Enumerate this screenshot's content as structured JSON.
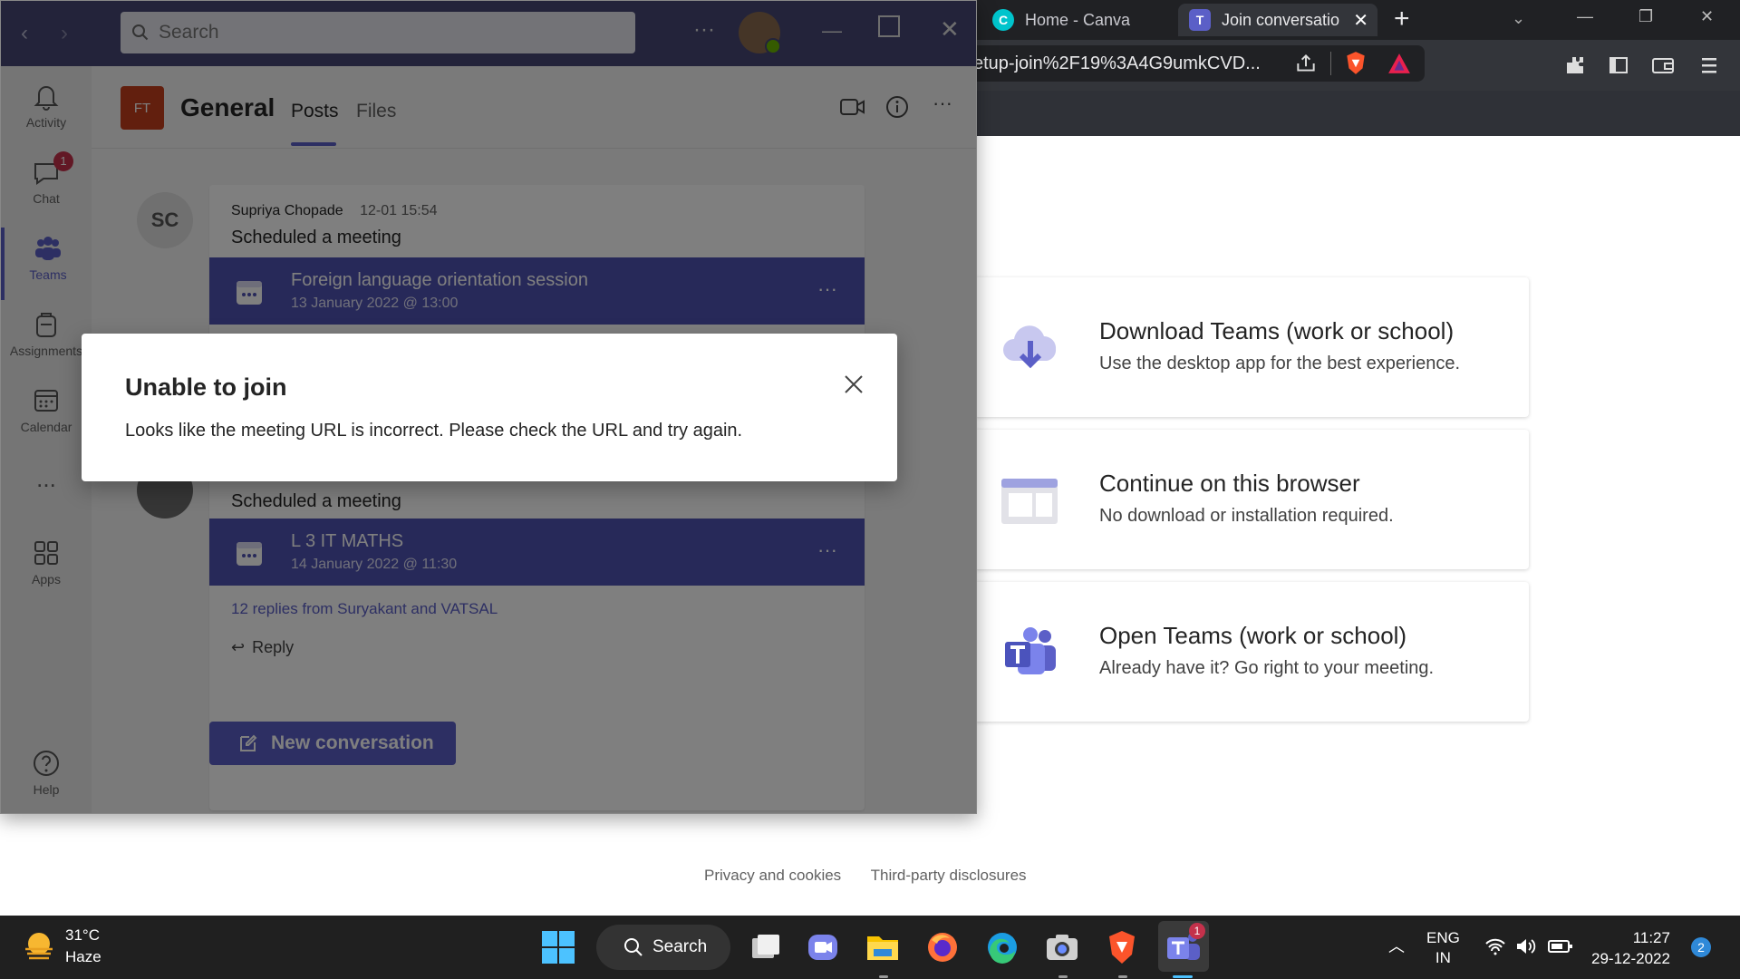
{
  "browser": {
    "tabs": [
      {
        "title": "Home - Canva",
        "icon": "canva-icon",
        "active": false
      },
      {
        "title": "Join conversatio",
        "icon": "teams-icon",
        "active": true
      }
    ],
    "url": "etup-join%2F19%3A4G9umkCVD..."
  },
  "join_options": [
    {
      "title": "Download Teams (work or school)",
      "subtitle": "Use the desktop app for the best experience.",
      "icon": "cloud-download-icon"
    },
    {
      "title": "Continue on this browser",
      "subtitle": "No download or installation required.",
      "icon": "browser-window-icon"
    },
    {
      "title": "Open Teams (work or school)",
      "subtitle": "Already have it? Go right to your meeting.",
      "icon": "teams-logo-icon"
    }
  ],
  "footer": {
    "privacy": "Privacy and cookies",
    "third_party": "Third-party disclosures"
  },
  "teams": {
    "search_placeholder": "Search",
    "rail": [
      {
        "label": "Activity",
        "icon": "bell-icon"
      },
      {
        "label": "Chat",
        "icon": "chat-icon",
        "badge": "1"
      },
      {
        "label": "Teams",
        "icon": "teams-icon",
        "active": true
      },
      {
        "label": "Assignments",
        "icon": "assignments-icon"
      },
      {
        "label": "Calendar",
        "icon": "calendar-icon"
      },
      {
        "label": "...",
        "icon": "more-icon"
      },
      {
        "label": "Apps",
        "icon": "apps-icon"
      },
      {
        "label": "Help",
        "icon": "help-icon"
      }
    ],
    "channel": {
      "avatar": "FT",
      "name": "General",
      "tabs": [
        "Posts",
        "Files"
      ]
    },
    "posts": [
      {
        "avatar": "SC",
        "author": "Supriya Chopade",
        "time": "12-01 15:54",
        "text": "Scheduled a meeting",
        "meeting": {
          "title": "Foreign language orientation session",
          "date": "13 January 2022 @ 13:00"
        }
      },
      {
        "text": "Scheduled a meeting",
        "meeting": {
          "title": "L 3 IT MATHS",
          "date": "14 January 2022 @ 11:30"
        },
        "replies": "12 replies from Suryakant and VATSAL",
        "reply_label": "Reply"
      }
    ],
    "new_conversation": "New conversation"
  },
  "dialog": {
    "title": "Unable to join",
    "message": "Looks like the meeting URL is incorrect. Please check the URL and try again."
  },
  "taskbar": {
    "weather": {
      "temp": "31°C",
      "condition": "Haze"
    },
    "search_label": "Search",
    "lang": [
      "ENG",
      "IN"
    ],
    "time": "11:27",
    "date": "29-12-2022",
    "notifications": "2",
    "teams_badge": "1"
  }
}
